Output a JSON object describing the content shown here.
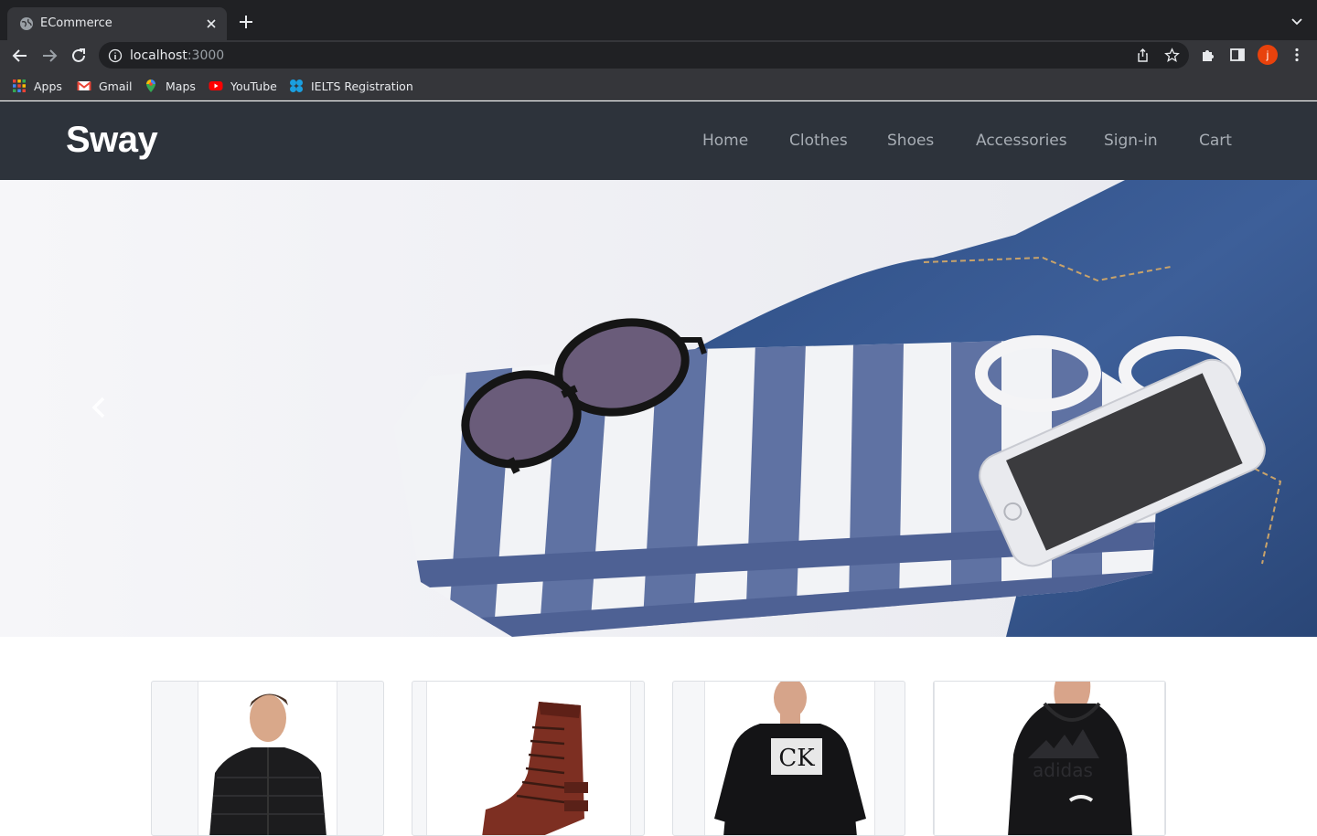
{
  "browser": {
    "tab_title": "ECommerce",
    "url_host": "localhost",
    "url_port": ":3000",
    "profile_initial": "j",
    "bookmarks": [
      {
        "label": "Apps",
        "icon": "apps-grid-icon"
      },
      {
        "label": "Gmail",
        "icon": "gmail-icon"
      },
      {
        "label": "Maps",
        "icon": "maps-icon"
      },
      {
        "label": "YouTube",
        "icon": "youtube-icon"
      },
      {
        "label": "IELTS Registration",
        "icon": "ielts-icon"
      }
    ]
  },
  "site": {
    "brand": "Sway",
    "nav": [
      "Home",
      "Clothes",
      "Shoes",
      "Accessories",
      "Sign-in",
      "Cart"
    ]
  },
  "hero": {
    "image": "striped-shirt-sunglasses-phone-jeans-photo"
  },
  "products": [
    {
      "image": "black-puffer-jacket-photo"
    },
    {
      "image": "brown-leather-boot-photo"
    },
    {
      "image": "black-calvin-klein-tshirt-photo"
    },
    {
      "image": "black-adidas-hoodie-photo"
    }
  ],
  "colors": {
    "chrome_dark": "#202124",
    "chrome_toolbar": "#35363a",
    "site_header": "#2d333b",
    "nav_link": "#a7adb4",
    "profile": "#e8420c"
  }
}
